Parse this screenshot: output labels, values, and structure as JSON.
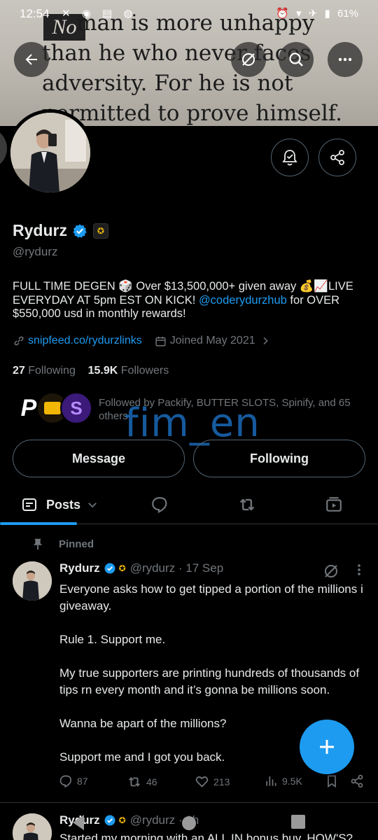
{
  "status": {
    "time": "12:54",
    "battery": "61%"
  },
  "banner": {
    "mark": "No",
    "lines": [
      "     man is more unhappy",
      "than he who never faces",
      "adversity. For he is not",
      "permitted to prove himself."
    ]
  },
  "profile": {
    "name": "Rydurz",
    "handle": "@rydurz",
    "bio_pre": "FULL TIME DEGEN 🎲 Over $13,500,000+ given away 💰📈LIVE EVERYDAY AT 5pm EST ON KICK! ",
    "bio_mention": "@coderydurzhub",
    "bio_post": " for OVER $550,000 usd in monthly rewards!",
    "link": "snipfeed.co/rydurzlinks",
    "joined": "Joined May 2021",
    "following_count": "27",
    "following_label": "Following",
    "followers_count": "15.9K",
    "followers_label": "Followers",
    "followed_by": "Followed by Packify, BUTTER SLOTS, Spinify, and 65 others"
  },
  "watermark": "fim_en",
  "buttons": {
    "message": "Message",
    "following": "Following"
  },
  "tabs": {
    "posts": "Posts"
  },
  "pinned_label": "Pinned",
  "post": {
    "name": "Rydurz",
    "handle": "@rydurz · 17 Sep",
    "body": "Everyone asks how to get tipped a portion of the millions i giveaway.\n\nRule 1. Support me.\n\nMy true supporters are printing hundreds of thousands of tips rn every month and it’s gonna be millions soon.\n\nWanna be apart of the millions?\n\nSupport me and I got you back.",
    "replies": "87",
    "reposts": "46",
    "likes": "213",
    "views": "9.5K"
  },
  "post2": {
    "name": "Rydurz",
    "handle": "@rydurz · 1h",
    "body_peek": "Started my morning with an ALL IN bonus buy. HOW'S?"
  },
  "colors": {
    "accent": "#1d9bf0",
    "muted": "#71767b",
    "border": "#2f3336"
  }
}
